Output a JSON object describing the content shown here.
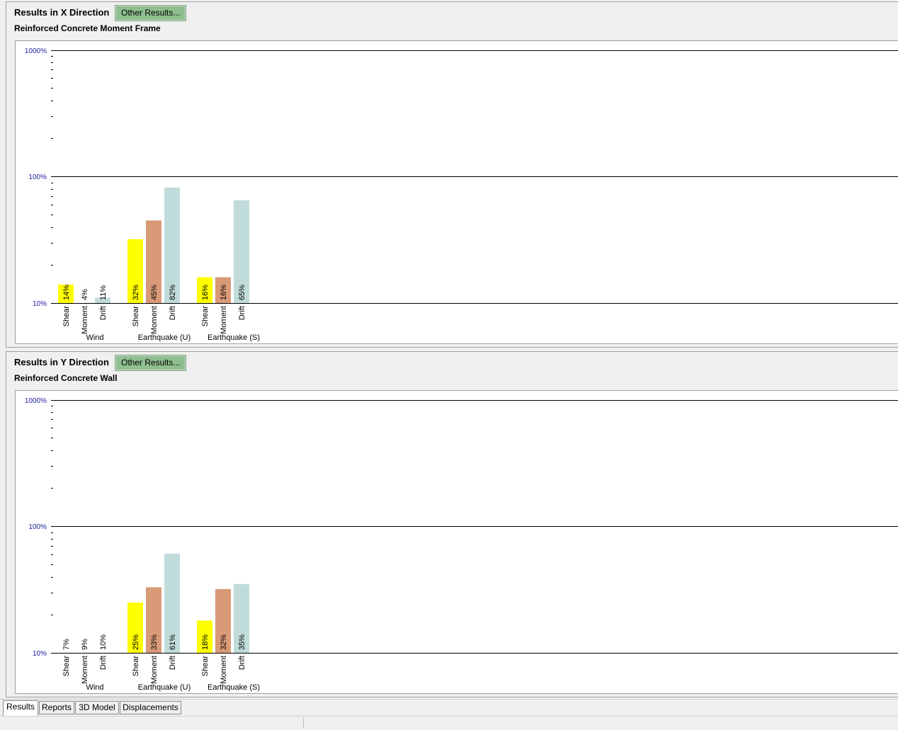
{
  "panels": [
    {
      "title": "Results in X Direction",
      "button": "Other Results...",
      "subtitle": "Reinforced Concrete Moment Frame"
    },
    {
      "title": "Results in Y Direction",
      "button": "Other Results...",
      "subtitle": "Reinforced Concrete Wall"
    }
  ],
  "tabs": [
    "Results",
    "Reports",
    "3D Model",
    "Displacements"
  ],
  "colors": {
    "shear": "#ffff00",
    "moment": "#d99a78",
    "drift": "#c0dcda",
    "axis_label": "#1a1aa0"
  },
  "chart_data": [
    {
      "type": "bar",
      "scale": "log",
      "ylim": [
        "10%",
        "1000%"
      ],
      "yticks": [
        "1000%",
        "100%",
        "10%"
      ],
      "grid": true,
      "groups": [
        "Wind",
        "Earthquake (U)",
        "Earthquake (S)"
      ],
      "bar_labels": [
        "Shear",
        "Moment",
        "Drift"
      ],
      "values": [
        [
          14,
          4,
          11
        ],
        [
          32,
          45,
          82
        ],
        [
          16,
          16,
          65
        ]
      ],
      "value_labels": [
        [
          "14%",
          "4%",
          "11%"
        ],
        [
          "32%",
          "45%",
          "82%"
        ],
        [
          "16%",
          "16%",
          "65%"
        ]
      ]
    },
    {
      "type": "bar",
      "scale": "log",
      "ylim": [
        "10%",
        "1000%"
      ],
      "yticks": [
        "1000%",
        "100%",
        "10%"
      ],
      "grid": true,
      "groups": [
        "Wind",
        "Earthquake (U)",
        "Earthquake (S)"
      ],
      "bar_labels": [
        "Shear",
        "Moment",
        "Drift"
      ],
      "values": [
        [
          7,
          9,
          10
        ],
        [
          25,
          33,
          61
        ],
        [
          18,
          32,
          35
        ]
      ],
      "value_labels": [
        [
          "7%",
          "9%",
          "10%"
        ],
        [
          "25%",
          "33%",
          "61%"
        ],
        [
          "18%",
          "32%",
          "35%"
        ]
      ]
    }
  ]
}
